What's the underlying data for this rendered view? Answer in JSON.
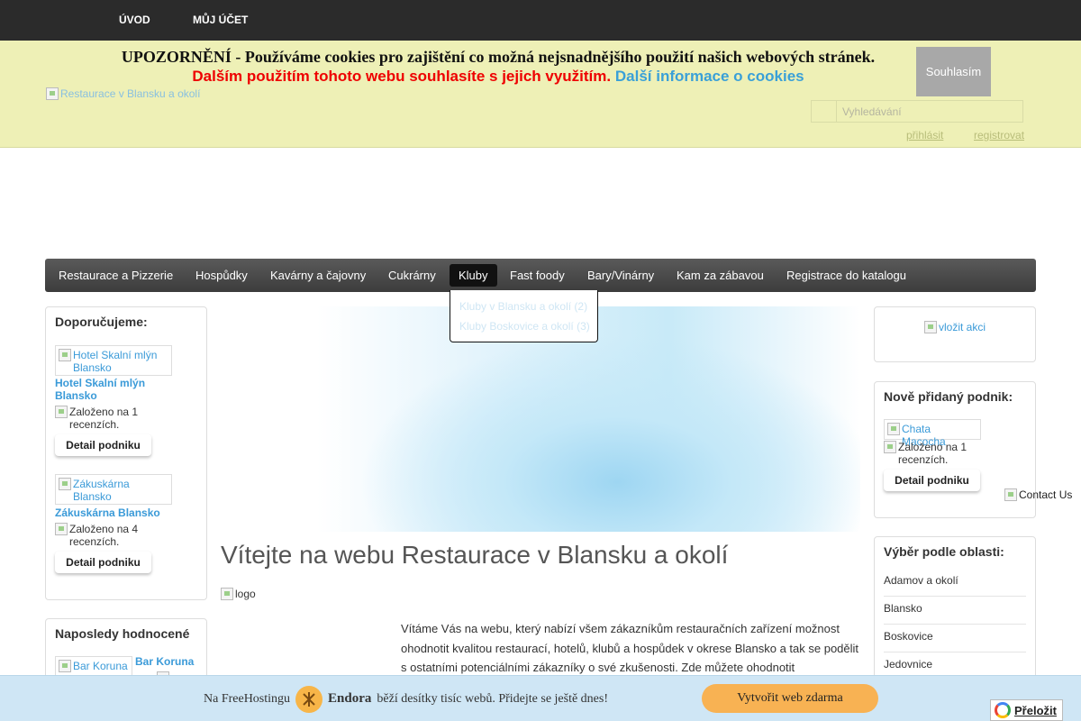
{
  "topnav": {
    "home": "ÚVOD",
    "account": "MŮJ ÚČET"
  },
  "cookie": {
    "line1": "UPOZORNĚNÍ - Používáme cookies pro zajištění co možná nejsnadnějšího použití našich webových stránek.",
    "line2_red": "Dalším použitím tohoto webu souhlasíte s jejich využitím.",
    "line2_link": "Další informace o cookies",
    "agree": "Souhlasím"
  },
  "header": {
    "logo_alt": "Restaurace v Blansku a okolí",
    "search_placeholder": "Vyhledávání",
    "login": "přihlásit",
    "register": "registrovat"
  },
  "mainnav": {
    "items": [
      "Restaurace a Pizzerie",
      "Hospůdky",
      "Kavárny a čajovny",
      "Cukrárny",
      "Kluby",
      "Fast foody",
      "Bary/Vinárny",
      "Kam za zábavou",
      "Registrace do katalogu"
    ],
    "active": "Kluby",
    "dropdown": [
      "Kluby v Blansku a okolí (2)",
      "Kluby Boskovice a okolí (3)"
    ]
  },
  "recommended": {
    "title": "Doporučujeme:",
    "items": [
      {
        "thumb": "Hotel Skalní mlýn Blansko",
        "name": "Hotel Skalní mlýn Blansko",
        "rating": "Založeno na 1 recenzích.",
        "detail": "Detail podniku"
      },
      {
        "thumb": "Zákuskárna Blansko",
        "name": "Zákuskárna Blansko",
        "rating": "Založeno na 4 recenzích.",
        "detail": "Detail podniku"
      }
    ]
  },
  "last_rated": {
    "title": "Naposledy hodnocené",
    "item": {
      "thumb": "Bar Koruna",
      "name": "Bar Koruna"
    }
  },
  "main": {
    "welcome": "Vítejte na webu Restaurace v Blansku a okolí",
    "logo_alt": "logo",
    "intro": "Vítáme Vás na webu, který nabízí všem zákazníkům restauračních zařízení možnost ohodnotit kvalitou restaurací, hotelů, klubů a hospůdek v okrese Blansko a tak se podělit s ostatními potenciálními zákazníky o své zkušenosti. Zde můžete ohodnotit"
  },
  "right": {
    "add_event": "vložit akci",
    "new_place": {
      "title": "Nově přidaný podnik:",
      "thumb": "Chata Macocha",
      "rating": "Založeno na 1 recenzích.",
      "detail": "Detail podniku"
    },
    "regions": {
      "title": "Výběr podle oblasti:",
      "items": [
        "Adamov a okolí",
        "Blansko",
        "Boskovice",
        "Jedovnice"
      ]
    },
    "contact": "Contact Us"
  },
  "bottom": {
    "text_pre": "Na FreeHostingu",
    "brand": "Endora",
    "text_post": "běží desítky tisíc webů. Přidejte se ještě dnes!",
    "button": "Vytvořit web zdarma"
  },
  "translate": "Přeložit",
  "colors": {
    "accent": "#3a9ad8",
    "header_bg": "#eef0b6",
    "bottom_bg": "#cfe6f5",
    "button_orange": "#f8b253",
    "red_notice": "#e00000"
  }
}
